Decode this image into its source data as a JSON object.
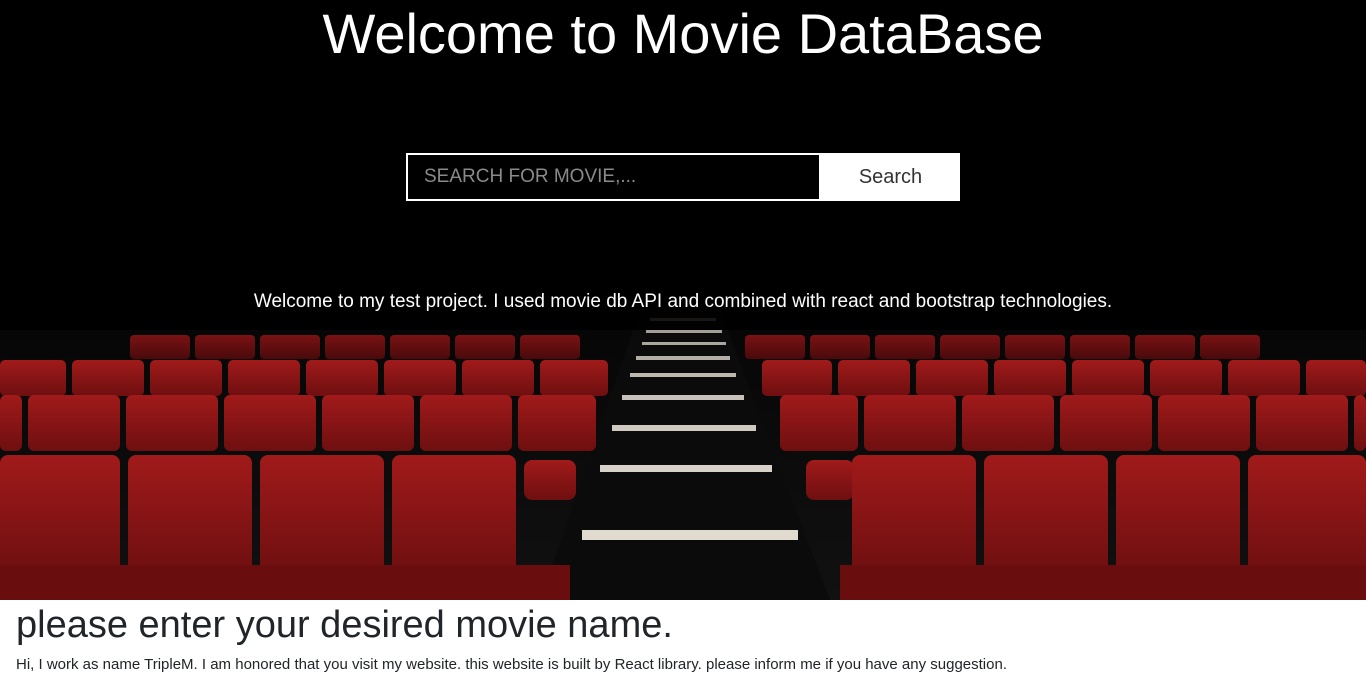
{
  "hero": {
    "title": "Welcome to Movie DataBase",
    "subtitle": "Welcome to my test project. I used movie db API and combined with react and bootstrap technologies.",
    "background_image": "cinema-red-seats-image"
  },
  "search": {
    "placeholder": "SEARCH FOR MOVIE,...",
    "value": "",
    "button_label": "Search"
  },
  "content": {
    "heading": "please enter your desired movie name.",
    "text": "Hi, I work as name TripleM. I am honored that you visit my website. this website is built by React library. please inform me if you have any suggestion."
  },
  "colors": {
    "hero_bg": "#000000",
    "seat_red": "#8e1515",
    "text_light": "#ffffff",
    "text_dark": "#212529"
  }
}
